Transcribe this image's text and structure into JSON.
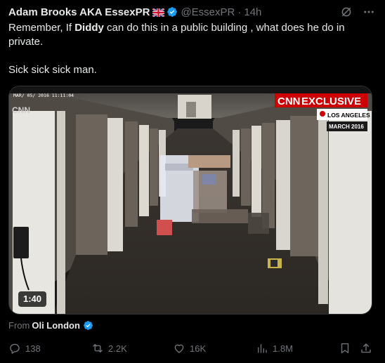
{
  "author": {
    "display_name": "Adam Brooks AKA EssexPR",
    "handle": "@EssexPR",
    "time": "14h",
    "flag_icon": "uk-flag-icon",
    "verified_icon": "verified-badge-icon"
  },
  "tweet": {
    "line1_pre": "Remember, If ",
    "line1_bold": "Diddy",
    "line1_post": " can do this in a public building , what does he do in private.",
    "line2": "Sick sick sick man."
  },
  "media": {
    "timestamp_overlay": "MAR/ 05/ 2016  11:11:04",
    "logo_small": "CNN",
    "banner_brand": "CNN",
    "banner_label": "EXCLUSIVE",
    "location": "LOS ANGELES",
    "date": "MARCH 2016",
    "duration": "1:40"
  },
  "attribution": {
    "from_label": "From",
    "source": "Oli London"
  },
  "actions": {
    "replies": "138",
    "reposts": "2.2K",
    "likes": "16K",
    "views": "1.8M"
  },
  "colors": {
    "background": "#000000",
    "text": "#e7e9ea",
    "muted": "#71767b",
    "verified": "#1d9bf0",
    "cnn_red": "#cc0000"
  }
}
